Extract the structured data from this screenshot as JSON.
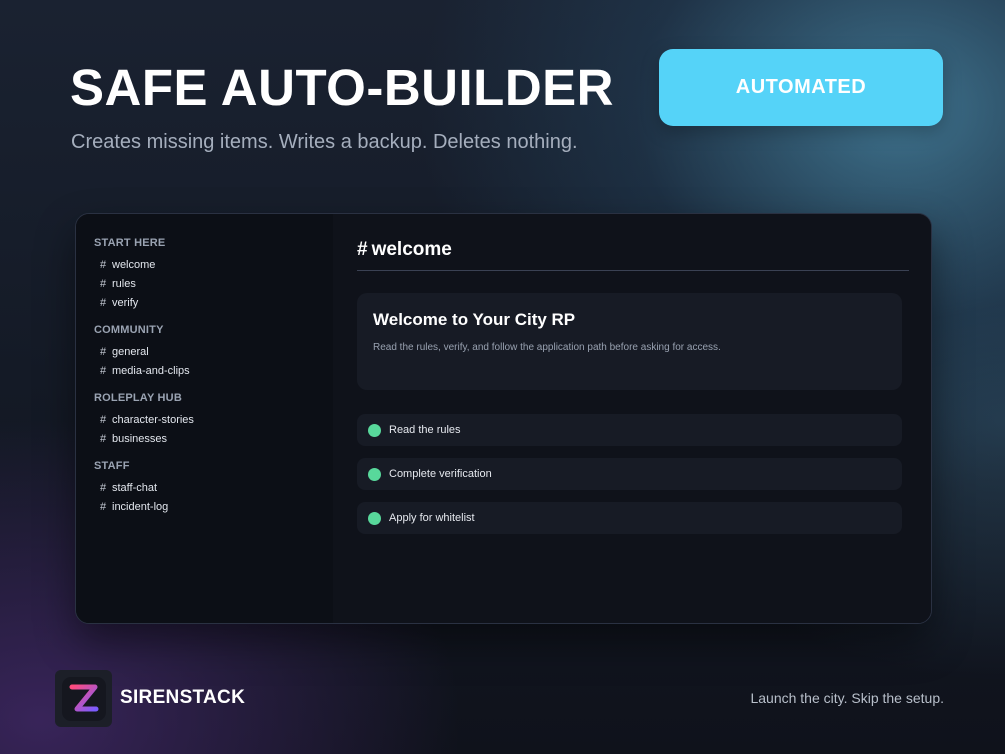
{
  "hero": {
    "title": "SAFE AUTO-BUILDER",
    "subtitle": "Creates missing items. Writes a backup. Deletes nothing.",
    "badge": "AUTOMATED"
  },
  "sidebar": {
    "categories": [
      {
        "label": "START HERE",
        "channels": [
          "welcome",
          "rules",
          "verify"
        ]
      },
      {
        "label": "COMMUNITY",
        "channels": [
          "general",
          "media-and-clips"
        ]
      },
      {
        "label": "ROLEPLAY HUB",
        "channels": [
          "character-stories",
          "businesses"
        ]
      },
      {
        "label": "STAFF",
        "channels": [
          "staff-chat",
          "incident-log"
        ]
      }
    ]
  },
  "main": {
    "channel_name": "welcome",
    "card": {
      "title": "Welcome to Your City RP",
      "description": "Read the rules, verify, and follow the application path before asking for access."
    },
    "steps": [
      "Read the rules",
      "Complete verification",
      "Apply for whitelist"
    ]
  },
  "footer": {
    "brand": "SIRENSTACK",
    "tagline": "Launch the city. Skip the setup."
  },
  "colors": {
    "accent": "#55d3f8",
    "step_dot": "#58d89b",
    "logo_gradient_start": "#ff4b7d",
    "logo_gradient_end": "#7b5cff"
  },
  "icons": {
    "channel": "hash-icon",
    "step": "status-dot-icon",
    "logo": "letter-z-logo"
  }
}
